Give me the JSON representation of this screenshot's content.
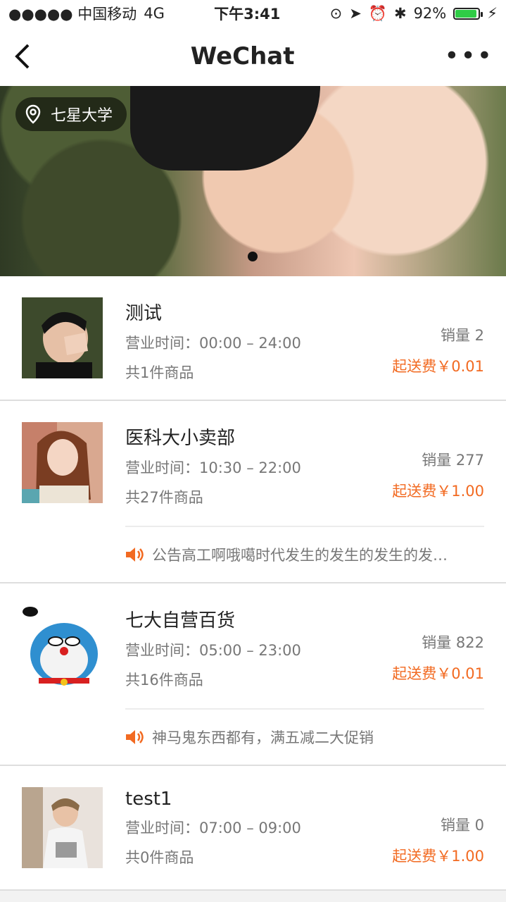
{
  "status_bar": {
    "carrier": "●●●●● 中国移动",
    "network": "4G",
    "time": "下午3:41",
    "battery": "92%",
    "battery_level": 0.92
  },
  "nav": {
    "title": "WeChat",
    "more": "•••"
  },
  "banner": {
    "location": "七星大学"
  },
  "stores": [
    {
      "name": "测试",
      "hours": "营业时间：00:00 – 24:00",
      "count": "共1件商品",
      "sales": "销量 2",
      "fee": "起送费￥0.01",
      "notice": ""
    },
    {
      "name": "医科大小卖部",
      "hours": "营业时间：10:30 – 22:00",
      "count": "共27件商品",
      "sales": "销量 277",
      "fee": "起送费￥1.00",
      "notice": "公告高工啊哦噶时代发生的发生的发生的发…"
    },
    {
      "name": "七大自营百货",
      "hours": "营业时间：05:00 – 23:00",
      "count": "共16件商品",
      "sales": "销量 822",
      "fee": "起送费￥0.01",
      "notice": "神马鬼东西都有，满五减二大促销"
    },
    {
      "name": "test1",
      "hours": "营业时间：07:00 – 09:00",
      "count": "共0件商品",
      "sales": "销量 0",
      "fee": "起送费￥1.00",
      "notice": ""
    }
  ],
  "colors": {
    "accent": "#f26a21",
    "battery": "#2fcc46"
  }
}
